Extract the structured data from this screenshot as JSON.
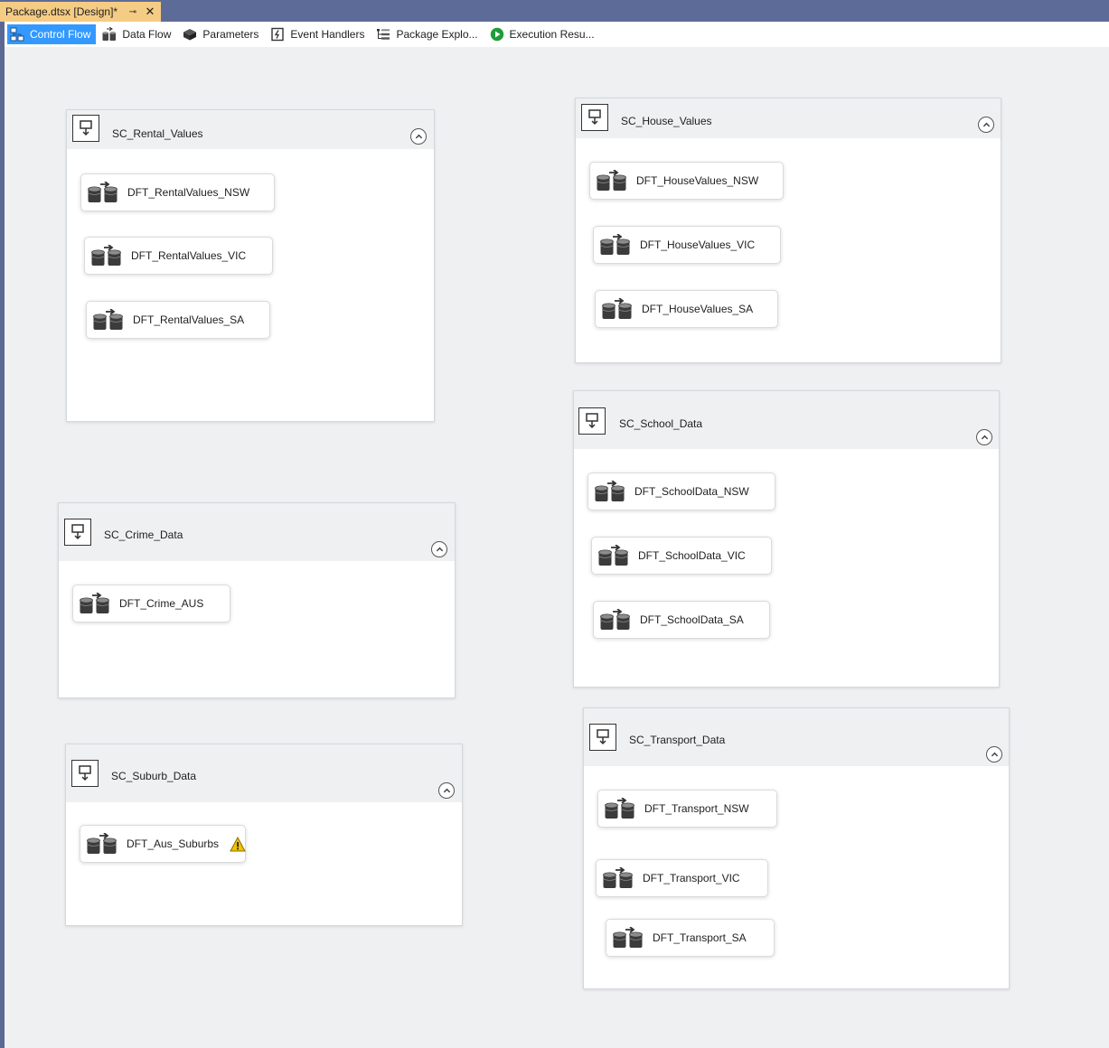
{
  "window": {
    "doc_tab": {
      "title": "Package.dtsx [Design]*",
      "pin_glyph": "⊸",
      "close_glyph": "✕",
      "color": "#f5cc84"
    }
  },
  "designer_tabs": [
    {
      "label": "Control Flow",
      "icon": "control-flow-icon",
      "active": true
    },
    {
      "label": "Data Flow",
      "icon": "data-flow-icon",
      "active": false
    },
    {
      "label": "Parameters",
      "icon": "parameters-icon",
      "active": false
    },
    {
      "label": "Event Handlers",
      "icon": "event-handlers-icon",
      "active": false
    },
    {
      "label": "Package Explo...",
      "icon": "package-explorer-icon",
      "active": false
    },
    {
      "label": "Execution Resu...",
      "icon": "execution-results-icon",
      "active": false
    }
  ],
  "containers": [
    {
      "title": "SC_Rental_Values",
      "tasks": [
        {
          "label": "DFT_RentalValues_NSW"
        },
        {
          "label": "DFT_RentalValues_VIC"
        },
        {
          "label": "DFT_RentalValues_SA"
        }
      ]
    },
    {
      "title": "SC_House_Values",
      "tasks": [
        {
          "label": "DFT_HouseValues_NSW"
        },
        {
          "label": "DFT_HouseValues_VIC"
        },
        {
          "label": "DFT_HouseValues_SA"
        }
      ]
    },
    {
      "title": "SC_School_Data",
      "tasks": [
        {
          "label": "DFT_SchoolData_NSW"
        },
        {
          "label": "DFT_SchoolData_VIC"
        },
        {
          "label": "DFT_SchoolData_SA"
        }
      ]
    },
    {
      "title": "SC_Crime_Data",
      "tasks": [
        {
          "label": "DFT_Crime_AUS"
        }
      ]
    },
    {
      "title": "SC_Suburb_Data",
      "tasks": [
        {
          "label": "DFT_Aus_Suburbs",
          "warning": true
        }
      ]
    },
    {
      "title": "SC_Transport_Data",
      "tasks": [
        {
          "label": "DFT_Transport_NSW"
        },
        {
          "label": "DFT_Transport_VIC"
        },
        {
          "label": "DFT_Transport_SA"
        }
      ]
    }
  ],
  "colors": {
    "active_tab": "#3399ff",
    "canvas": "#eff0f2",
    "chrome": "#5d6b98",
    "warning": "#f2c200"
  }
}
